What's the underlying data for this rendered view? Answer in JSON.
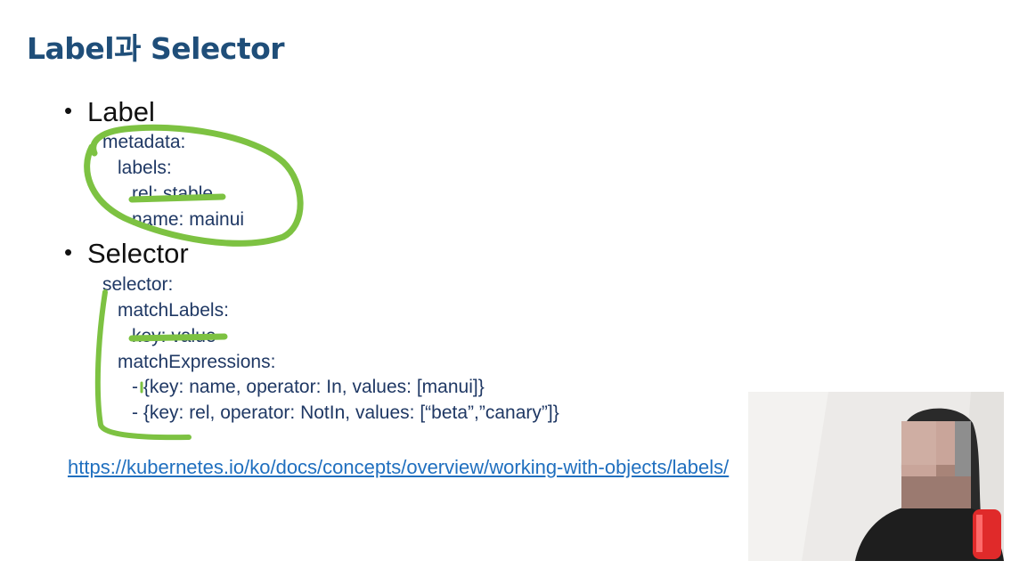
{
  "slide": {
    "title": "Label과 Selector",
    "bullets": [
      {
        "label": "Label",
        "code": [
          "metadata:",
          "labels:",
          "rel: stable",
          "name: mainui"
        ]
      },
      {
        "label": "Selector",
        "code": [
          "selector:",
          "matchLabels:",
          "key: value",
          "matchExpressions:",
          "- {key: name, operator: In, values: [manui]}",
          "- {key: rel, operator: NotIn, values: [“beta”,”canary”]}"
        ]
      }
    ],
    "link": "https://kubernetes.io/ko/docs/concepts/overview/working-with-objects/labels/"
  },
  "annotations": {
    "marker_color": "#7dc242"
  },
  "webcam": {
    "background_color": "#eceae8",
    "person_colors": [
      "#2a2a2a",
      "#c9a59a",
      "#9b7a70",
      "#e02a2a"
    ]
  }
}
